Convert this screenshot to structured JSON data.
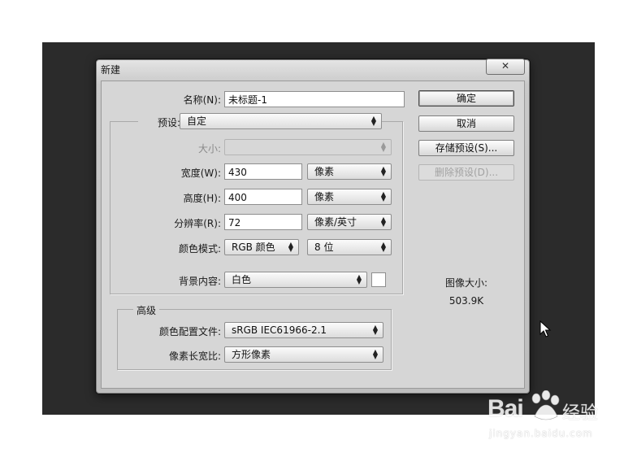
{
  "dialog": {
    "title": "新建",
    "close_glyph": "✕"
  },
  "form": {
    "name_label": "名称(N):",
    "name_value": "未标题-1",
    "preset_label": "预设:",
    "preset_value": "自定",
    "size_label": "大小:",
    "size_value": "",
    "width_label": "宽度(W):",
    "width_value": "430",
    "width_unit": "像素",
    "height_label": "高度(H):",
    "height_value": "400",
    "height_unit": "像素",
    "resolution_label": "分辨率(R):",
    "resolution_value": "72",
    "resolution_unit": "像素/英寸",
    "color_mode_label": "颜色模式:",
    "color_mode_value": "RGB 颜色",
    "bit_depth_value": "8 位",
    "background_label": "背景内容:",
    "background_value": "白色",
    "background_swatch_color": "#ffffff"
  },
  "advanced": {
    "legend": "高级",
    "profile_label": "颜色配置文件:",
    "profile_value": "sRGB IEC61966-2.1",
    "pixel_aspect_label": "像素长宽比:",
    "pixel_aspect_value": "方形像素"
  },
  "buttons": {
    "ok": "确定",
    "cancel": "取消",
    "save_preset": "存储预设(S)...",
    "delete_preset": "删除预设(D)..."
  },
  "image_size": {
    "label": "图像大小:",
    "value": "503.9K"
  },
  "watermark": {
    "brand": "Bai",
    "brand2": "经验",
    "url": "jingyan.baidu.com"
  },
  "colors": {
    "backdrop": "#2b2b2b",
    "dialog_face": "#d6d6d6"
  }
}
